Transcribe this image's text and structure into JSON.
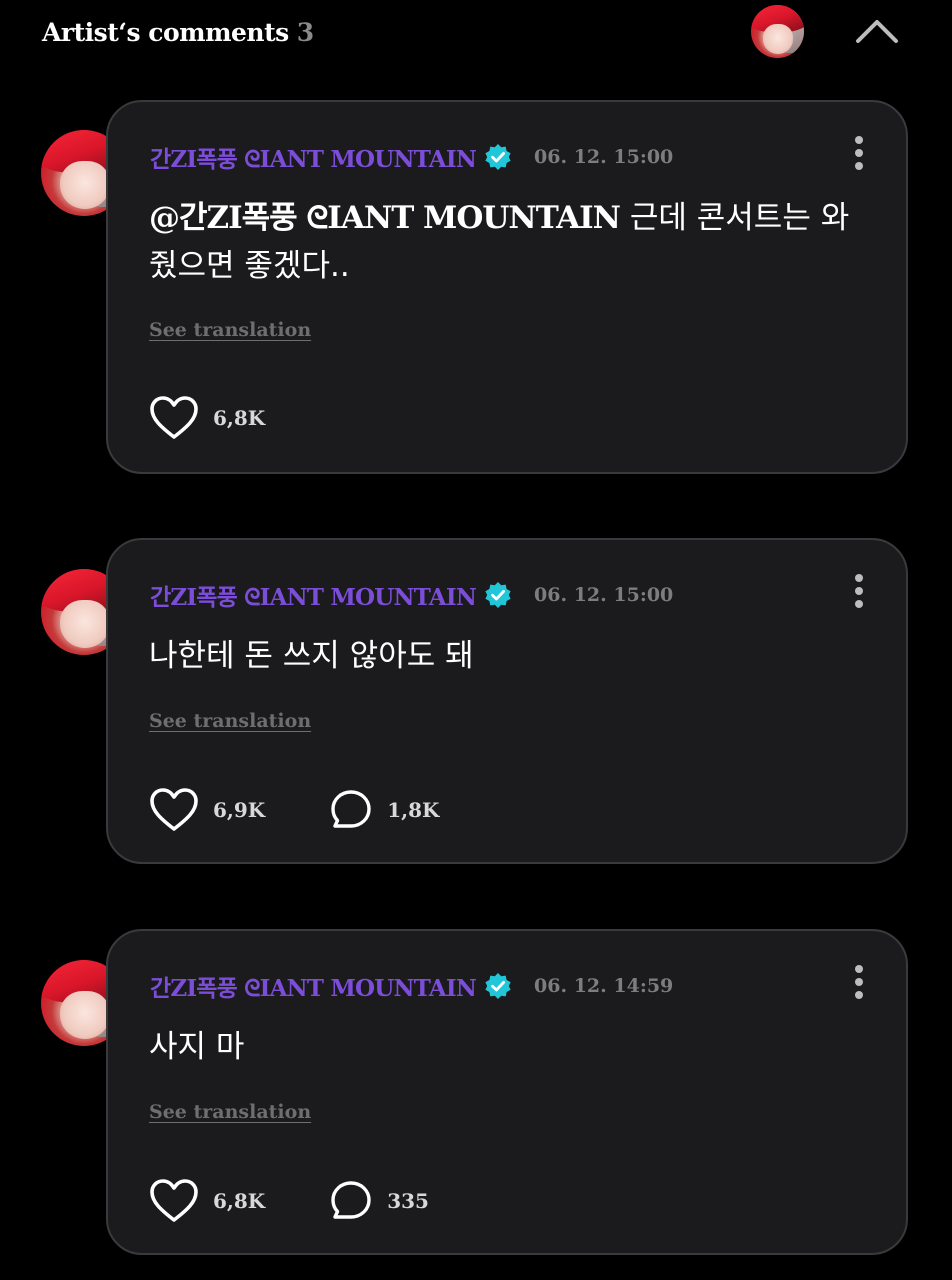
{
  "header": {
    "title": "Artist‘s comments",
    "count": "3",
    "collapse_icon": "chevron-up-icon"
  },
  "colors": {
    "background": "#000000",
    "card_background": "#1b1b1d",
    "card_border": "#3a3a3c",
    "author": "#7c4dd8",
    "verified": "#21c7d9",
    "timestamp": "#7d7d7d",
    "see_translation": "#6e6e6e"
  },
  "comments": [
    {
      "author": "간ZI폭풍 ᘓIANT MOUNTAIN",
      "verified_icon": "verified-badge-icon",
      "timestamp": "06. 12. 15:00",
      "mention": "@간ZI폭풍 ᘓIANT MOUNTAIN",
      "text": " 근데 콘서트는 와줬으면 좋겠다..",
      "see_translation": "See translation",
      "likes": "6,8K",
      "replies": null
    },
    {
      "author": "간ZI폭풍 ᘓIANT MOUNTAIN",
      "verified_icon": "verified-badge-icon",
      "timestamp": "06. 12. 15:00",
      "mention": "",
      "text": "나한테 돈 쓰지 않아도 돼",
      "see_translation": "See translation",
      "likes": "6,9K",
      "replies": "1,8K"
    },
    {
      "author": "간ZI폭풍 ᘓIANT MOUNTAIN",
      "verified_icon": "verified-badge-icon",
      "timestamp": "06. 12. 14:59",
      "mention": "",
      "text": "사지 마",
      "see_translation": "See translation",
      "likes": "6,8K",
      "replies": "335"
    }
  ]
}
